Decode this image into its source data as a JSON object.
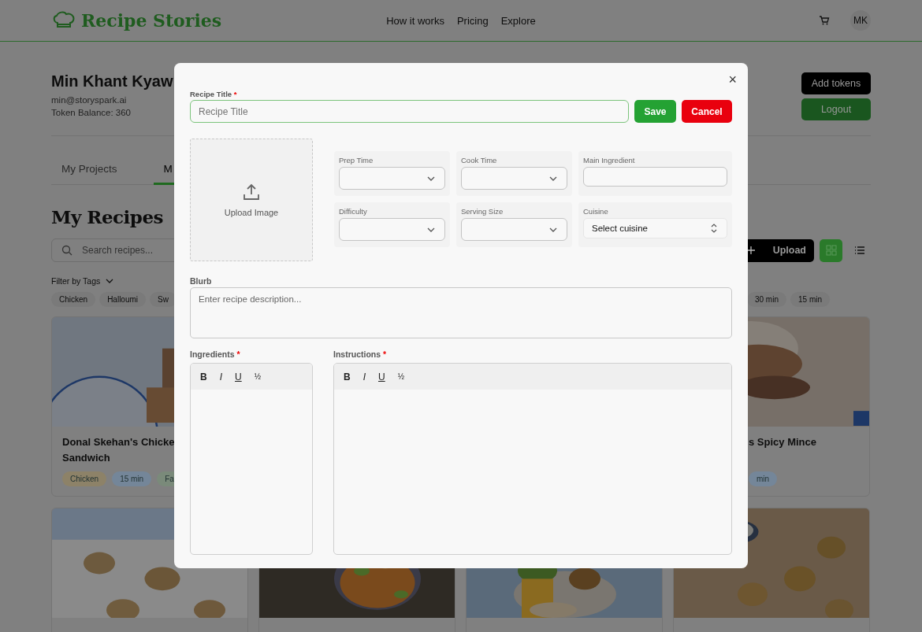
{
  "header": {
    "logo": "Recipe Stories",
    "nav": [
      "How it works",
      "Pricing",
      "Explore"
    ],
    "avatar": "MK"
  },
  "profile": {
    "name": "Min Khant Kyaw",
    "email": "min@storyspark.ai",
    "token_balance": "Token Balance: 360",
    "buttons": [
      {
        "label": "Add tokens",
        "kind": "dark"
      },
      {
        "label": "Logout",
        "kind": "green"
      }
    ]
  },
  "tabs": [
    {
      "label": "My Projects",
      "selected": false
    },
    {
      "label": "M",
      "selected": true
    }
  ],
  "heading": "My Recipes",
  "search": {
    "placeholder": "Search recipes..."
  },
  "upload": {
    "label": "Upload"
  },
  "views": [
    {
      "kind": "grid",
      "selected": true
    },
    {
      "kind": "list",
      "selected": false
    }
  ],
  "filter": {
    "label": "Filter by Tags",
    "tags_left": [
      "Chicken",
      "Halloumi",
      "Sw"
    ],
    "tags_right": [
      "30 min",
      "15 min"
    ]
  },
  "cards": [
    {
      "kind": "picture",
      "title_lines": [
        "Donal Skehan's Chicke",
        "Sandwich"
      ],
      "tags": [
        {
          "label": "Chicken",
          "color": "#8d8268"
        },
        {
          "label": "15 min",
          "color": "#748699"
        },
        {
          "label": "Fa",
          "color": "#7a8a7a"
        }
      ]
    },
    {
      "kind": "picture",
      "title_lines": [
        "s Spicy Mince"
      ],
      "tags": [
        {
          "label": "min",
          "color": "#748699"
        }
      ]
    },
    {
      "kind": "picture"
    },
    {
      "kind": "picture"
    },
    {
      "kind": "picture"
    },
    {
      "kind": "picture"
    }
  ],
  "modal": {
    "close": "×",
    "title_field": {
      "label": "Recipe Title",
      "required_mark": "*",
      "placeholder": "Recipe Title"
    },
    "save": "Save",
    "cancel": "Cancel",
    "upload": "Upload Image",
    "fields": [
      {
        "label": "Prep Time",
        "kind": "select"
      },
      {
        "label": "Cook Time",
        "kind": "select"
      },
      {
        "label": "Main Ingredient",
        "kind": "input"
      },
      {
        "label": "Difficulty",
        "kind": "select"
      },
      {
        "label": "Serving Size",
        "kind": "select"
      },
      {
        "label": "Cuisine",
        "kind": "picker",
        "value": "Select cuisine"
      }
    ],
    "blurb": {
      "label": "Blurb",
      "placeholder": "Enter recipe description..."
    },
    "editors": [
      {
        "label": "Ingredients",
        "required_mark": "*",
        "tools": [
          {
            "label": "B",
            "kind": "bold"
          },
          {
            "label": "I",
            "kind": "italic"
          },
          {
            "label": "U",
            "kind": "underline"
          },
          {
            "label": "½",
            "kind": "fraction"
          }
        ]
      },
      {
        "label": "Instructions",
        "required_mark": "*",
        "tools": [
          {
            "label": "B",
            "kind": "bold"
          },
          {
            "label": "I",
            "kind": "italic"
          },
          {
            "label": "U",
            "kind": "underline"
          },
          {
            "label": "½",
            "kind": "fraction"
          }
        ]
      }
    ]
  }
}
